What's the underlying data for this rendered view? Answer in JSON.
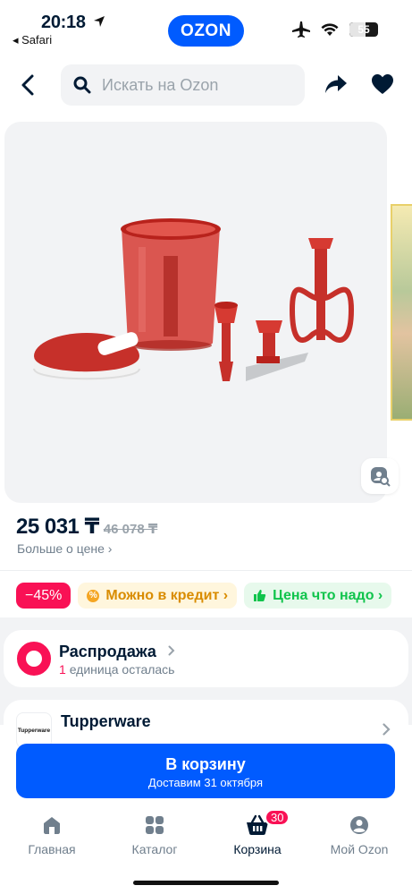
{
  "status_bar": {
    "time": "20:18",
    "back_app": "◂ Safari",
    "battery": "55"
  },
  "header": {
    "logo": "OZON",
    "search_placeholder": "Искать на Ozon"
  },
  "product": {
    "price": "25 031 ₸",
    "old_price": "46 078 ₸",
    "more_about_price": "Больше о цене ›"
  },
  "badges": [
    {
      "label": "−45%"
    },
    {
      "label": "Можно в кредит ›",
      "icon": "percent-icon"
    },
    {
      "label": "Цена что надо ›",
      "icon": "thumbs-up-icon"
    }
  ],
  "sale": {
    "title": "Распродажа",
    "count": "1",
    "subtitle": "единица осталась"
  },
  "brand": {
    "logo_text": "Tupperware",
    "name": "Tupperware"
  },
  "cart_button": {
    "label": "В корзину",
    "delivery": "Доставим 31 октября"
  },
  "tabbar": {
    "tabs": [
      {
        "label": "Главная",
        "icon": "home-icon"
      },
      {
        "label": "Каталог",
        "icon": "catalog-grid-icon"
      },
      {
        "label": "Корзина",
        "icon": "basket-icon",
        "active": true
      },
      {
        "label": "Мой Ozon",
        "icon": "profile-icon"
      }
    ],
    "cart_count": "30"
  },
  "colors": {
    "brand_blue": "#005bff",
    "accent_pink": "#f91155",
    "credit_orange": "#d98c00",
    "fair_price_green": "#10c44c"
  }
}
